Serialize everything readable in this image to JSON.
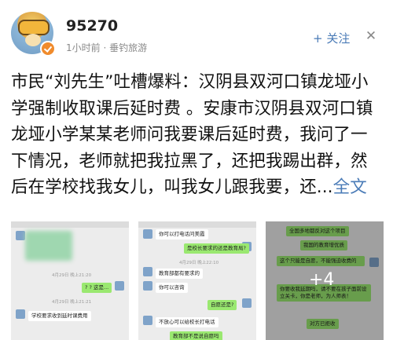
{
  "header": {
    "username": "95270",
    "meta": "1小时前 · 垂钓旅游",
    "follow_label": "+ 关注",
    "close_glyph": "✕"
  },
  "post": {
    "text": "市民“刘先生”吐槽爆料：汉阴县双河口镇龙垭小学强制收取课后延时费 。安康市汉阴县双河口镇龙垭小学某某老师问我要课后延时费，我问了一下情况，老师就把我拉黑了，还把我踢出群，然后在学校找我女儿，叫我女儿跟我要，还...",
    "full_text_link": "全文"
  },
  "gallery": {
    "image1": {
      "time1": "4月29日 晚上21:20",
      "bubble1": "? ? 这是...",
      "time2": "4月29日 晚上21:21",
      "bubble2": "学校要求收到延时课费用"
    },
    "image2": {
      "bubble1": "你可以打电话问美霞",
      "bubble2": "是校长要求的还是教育局?",
      "time1": "4月29日 晚上22:10",
      "bubble3": "教育部都有要求的",
      "bubble4": "你可以咨询",
      "bubble5": "自愿还是?",
      "bubble6": "不放心可以给校长打电话",
      "bubble7": "教育部不是说自愿吗"
    },
    "image3": {
      "bubble1": "全国多地都反对这个项目",
      "bubble2": "我国的教育增优质",
      "bubble3": "这个只能是自愿，不能强迫收费的",
      "bubble4": "你要收我延期吗，请不要在孩子面前设立关卡，你是老师，为人师表！",
      "bubble5": "对方已拒收",
      "more_count": "+4"
    }
  }
}
